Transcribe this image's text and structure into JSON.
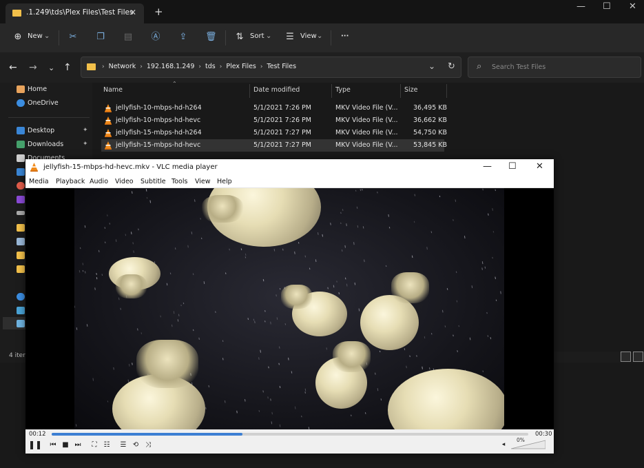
{
  "explorer": {
    "tab_title": ".1.249\\tds\\Plex Files\\Test Files",
    "toolbar": {
      "new_label": "New",
      "sort_label": "Sort",
      "view_label": "View",
      "more_label": "···"
    },
    "breadcrumbs": [
      "Network",
      "192.168.1.249",
      "tds",
      "Plex Files",
      "Test Files"
    ],
    "search_placeholder": "Search Test Files",
    "sidebar": [
      {
        "label": "Home",
        "color": "#e8a35c"
      },
      {
        "label": "OneDrive",
        "color": "#3b8de0"
      },
      {
        "label": "Desktop",
        "color": "#3a86d6"
      },
      {
        "label": "Downloads",
        "color": "#45a06b"
      },
      {
        "label": "Documents",
        "color": "#cfcfcf"
      }
    ],
    "columns": [
      "Name",
      "Date modified",
      "Type",
      "Size"
    ],
    "files": [
      {
        "name": "jellyfish-10-mbps-hd-h264",
        "date": "5/1/2021 7:26 PM",
        "type": "MKV Video File (V...",
        "size": "36,495 KB"
      },
      {
        "name": "jellyfish-10-mbps-hd-hevc",
        "date": "5/1/2021 7:26 PM",
        "type": "MKV Video File (V...",
        "size": "36,662 KB"
      },
      {
        "name": "jellyfish-15-mbps-hd-h264",
        "date": "5/1/2021 7:27 PM",
        "type": "MKV Video File (V...",
        "size": "54,750 KB"
      },
      {
        "name": "jellyfish-15-mbps-hd-hevc",
        "date": "5/1/2021 7:27 PM",
        "type": "MKV Video File (V...",
        "size": "53,845 KB"
      }
    ],
    "status_count": "4 iter"
  },
  "vlc": {
    "title": "jellyfish-15-mbps-hd-hevc.mkv - VLC media player",
    "menu": [
      "Media",
      "Playback",
      "Audio",
      "Video",
      "Subtitle",
      "Tools",
      "View",
      "Help"
    ],
    "time_elapsed": "00:12",
    "time_total": "00:30",
    "progress": 0.4,
    "volume_label": "0%",
    "accent": "#3c7fd3"
  }
}
